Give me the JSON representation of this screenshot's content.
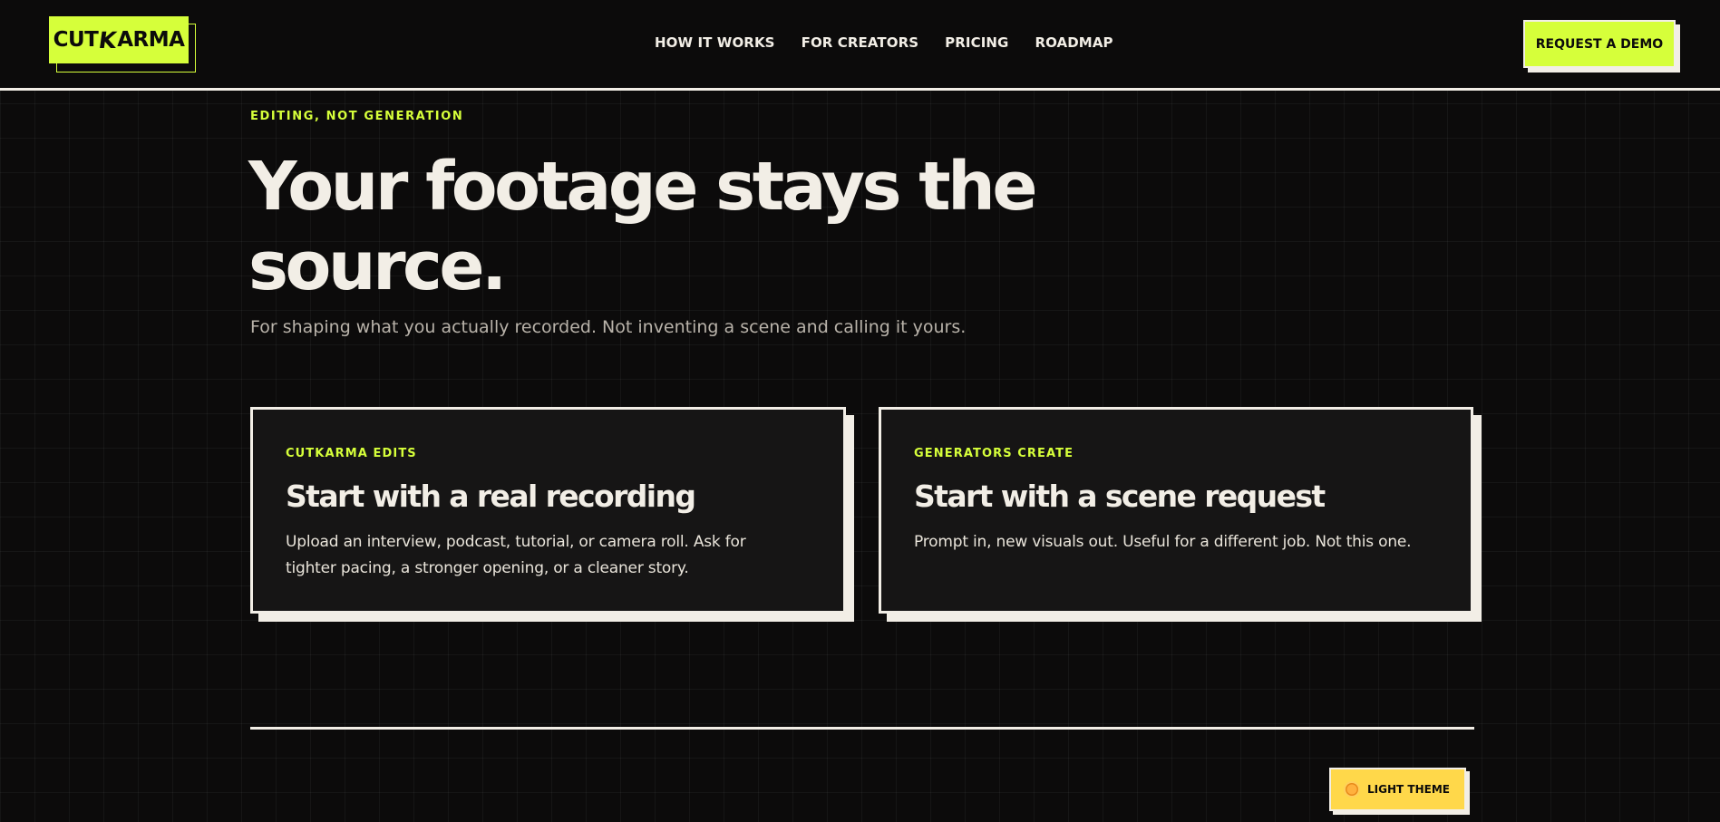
{
  "header": {
    "logo": {
      "left": "CUT",
      "k": "K",
      "right": "ARMA"
    },
    "nav": [
      {
        "label": "HOW IT WORKS"
      },
      {
        "label": "FOR CREATORS"
      },
      {
        "label": "PRICING"
      },
      {
        "label": "ROADMAP"
      }
    ],
    "cta_label": "REQUEST A DEMO"
  },
  "hero": {
    "eyebrow": "EDITING, NOT GENERATION",
    "title_line1": "Your footage stays the",
    "title_line2": "source.",
    "subtitle": "For shaping what you actually recorded. Not inventing a scene and calling it yours."
  },
  "cards": [
    {
      "eyebrow": "CUTKARMA EDITS",
      "title": "Start with a real recording",
      "body": "Upload an interview, podcast, tutorial, or camera roll. Ask for tighter pacing, a stronger opening, or a cleaner story."
    },
    {
      "eyebrow": "GENERATORS CREATE",
      "title": "Start with a scene request",
      "body": "Prompt in, new visuals out. Useful for a different job. Not this one."
    }
  ],
  "theme_toggle": {
    "label": "LIGHT THEME",
    "icon": "sun-icon"
  },
  "colors": {
    "background": "#0c0b0b",
    "accent": "#d6ff3a",
    "text": "#f2eee6",
    "theme_button": "#ffd84a"
  }
}
